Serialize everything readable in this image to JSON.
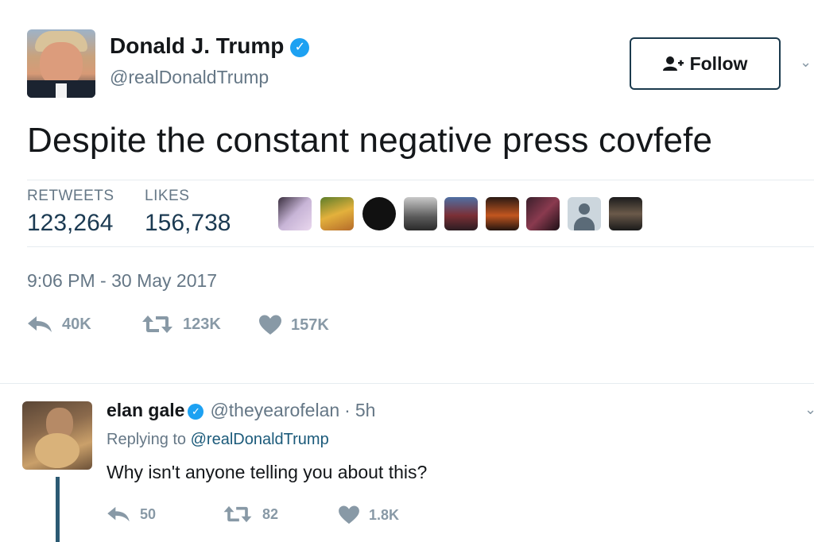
{
  "tweet": {
    "author": {
      "name": "Donald J. Trump",
      "handle": "@realDonaldTrump"
    },
    "follow_label": "Follow",
    "text": "Despite the constant negative press covfefe",
    "stats": {
      "retweets_label": "RETWEETS",
      "retweets_value": "123,264",
      "likes_label": "LIKES",
      "likes_value": "156,738"
    },
    "timestamp": "9:06 PM - 30 May 2017",
    "actions": {
      "reply_count": "40K",
      "retweet_count": "123K",
      "like_count": "157K"
    }
  },
  "reply": {
    "author_name": "elan gale",
    "handle": "@theyearofelan",
    "separator": "·",
    "time": "5h",
    "replying_to_prefix": "Replying to",
    "replying_to_handle": "@realDonaldTrump",
    "text": "Why isn't anyone telling you about this?",
    "actions": {
      "reply_count": "50",
      "retweet_count": "82",
      "like_count": "1.8K"
    }
  },
  "icons": {
    "verified": "verified-badge-icon",
    "follow": "add-user-icon",
    "reply": "reply-arrow-icon",
    "retweet": "retweet-icon",
    "like": "heart-icon"
  },
  "colors": {
    "verified": "#1da1f2",
    "text_primary": "#14171a",
    "text_secondary": "#657786",
    "stat_value": "#1b3a52",
    "icon_gray": "#8899a6"
  }
}
